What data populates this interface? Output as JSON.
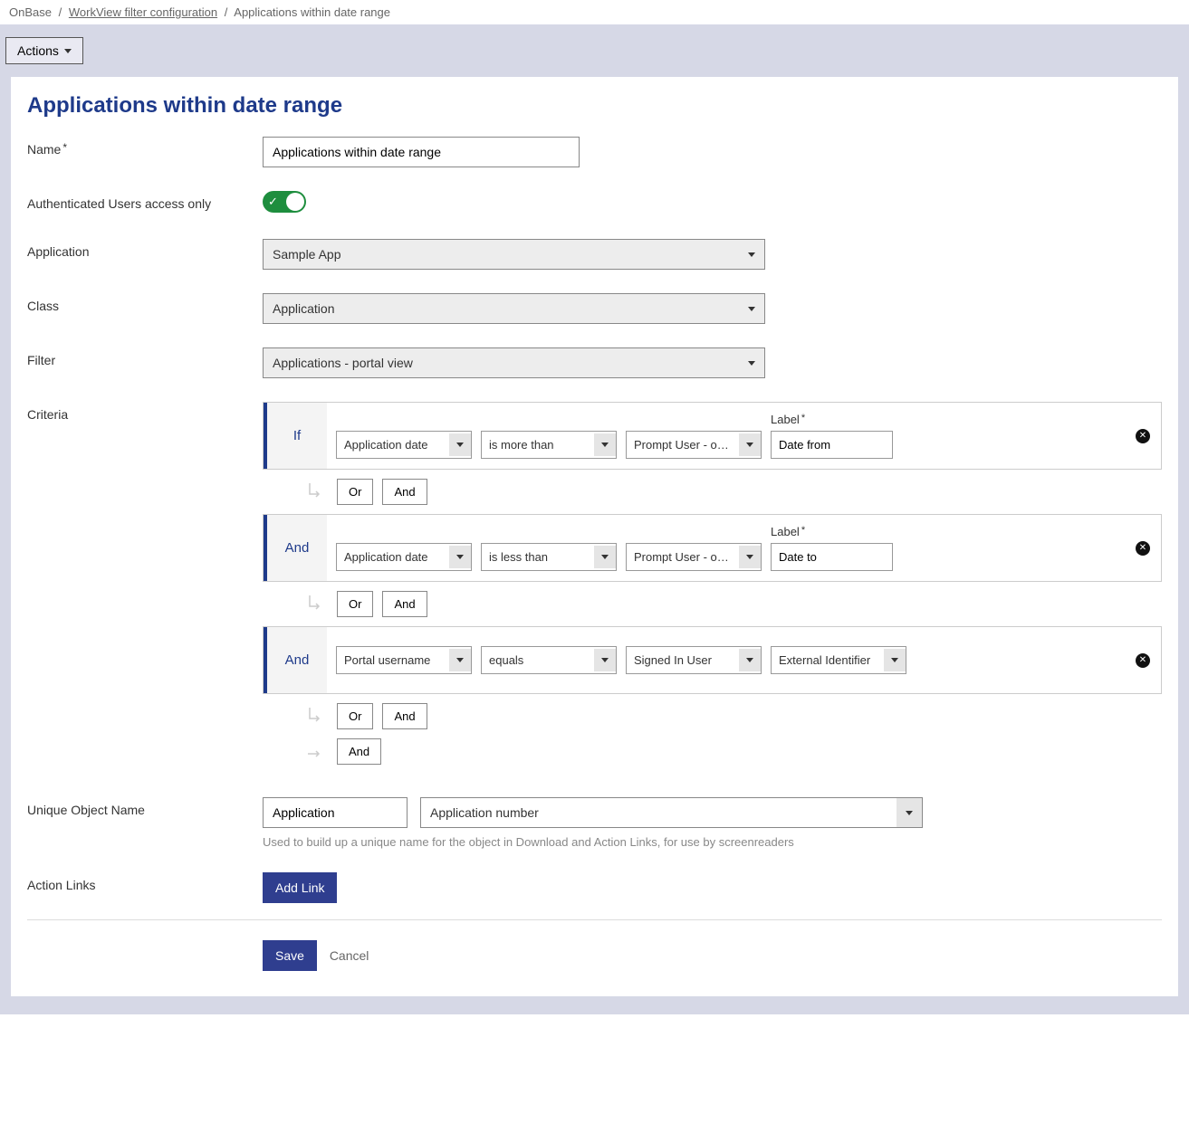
{
  "breadcrumb": {
    "root": "OnBase",
    "link": "WorkView filter configuration",
    "current": "Applications within date range"
  },
  "actions_button": "Actions",
  "page_title": "Applications within date range",
  "labels": {
    "name": "Name",
    "auth_only": "Authenticated Users access only",
    "application": "Application",
    "class": "Class",
    "filter": "Filter",
    "criteria": "Criteria",
    "unique": "Unique Object Name",
    "action_links": "Action Links",
    "label_field": "Label"
  },
  "form": {
    "name_value": "Applications within date range",
    "auth_only_on": true,
    "application_value": "Sample App",
    "class_value": "Application",
    "filter_value": "Applications - portal view"
  },
  "criteria": [
    {
      "gate": "If",
      "attribute": "Application date",
      "operator": "is more than",
      "value_source": "Prompt User - opt...",
      "label_value": "Date from",
      "show_label_header": true
    },
    {
      "gate": "And",
      "attribute": "Application date",
      "operator": "is less than",
      "value_source": "Prompt User - opt...",
      "label_value": "Date to",
      "show_label_header": true
    },
    {
      "gate": "And",
      "attribute": "Portal username",
      "operator": "equals",
      "value_source": "Signed In User",
      "extra_select": "External Identifier",
      "show_label_header": false
    }
  ],
  "sub_buttons": {
    "or": "Or",
    "and": "And"
  },
  "unique": {
    "text_value": "Application",
    "select_value": "Application number",
    "help": "Used to build up a unique name for the object in Download and Action Links, for use by screenreaders"
  },
  "buttons": {
    "add_link": "Add Link",
    "save": "Save",
    "cancel": "Cancel"
  }
}
